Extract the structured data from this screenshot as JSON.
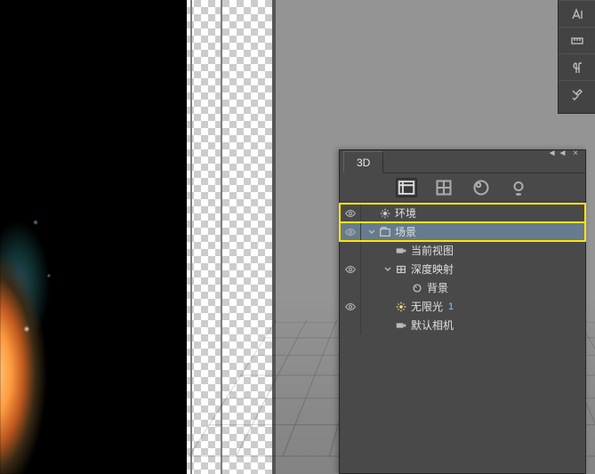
{
  "right_tools": [
    "text-icon",
    "ruler-icon",
    "pilcrow-icon",
    "tools-icon"
  ],
  "panel": {
    "menu_hint": "◄◄ ×",
    "tab_label": "3D",
    "filters": [
      {
        "name": "filter-scene-icon",
        "active": true
      },
      {
        "name": "filter-mesh-icon",
        "active": false
      },
      {
        "name": "filter-material-icon",
        "active": false
      },
      {
        "name": "filter-light-icon",
        "active": false
      }
    ],
    "tree": [
      {
        "eye": true,
        "depth": 0,
        "twisty": "none",
        "icon": "env-icon",
        "label": "环境",
        "highlight": true,
        "selected": false
      },
      {
        "eye": true,
        "depth": 0,
        "twisty": "open",
        "icon": "scene-icon",
        "label": "场景",
        "highlight": true,
        "selected": true
      },
      {
        "eye": false,
        "depth": 1,
        "twisty": "none",
        "icon": "camera-icon",
        "label": "当前视图",
        "highlight": false,
        "selected": false
      },
      {
        "eye": true,
        "depth": 1,
        "twisty": "open",
        "icon": "mesh-icon",
        "label": "深度映射",
        "highlight": false,
        "selected": false
      },
      {
        "eye": false,
        "depth": 2,
        "twisty": "none",
        "icon": "material-icon",
        "label": "背景",
        "highlight": false,
        "selected": false
      },
      {
        "eye": true,
        "depth": 1,
        "twisty": "none",
        "icon": "light-icon",
        "label": "无限光",
        "badge": "1",
        "highlight": false,
        "selected": false
      },
      {
        "eye": false,
        "depth": 1,
        "twisty": "none",
        "icon": "camera-icon",
        "label": "默认相机",
        "highlight": false,
        "selected": false
      }
    ]
  }
}
